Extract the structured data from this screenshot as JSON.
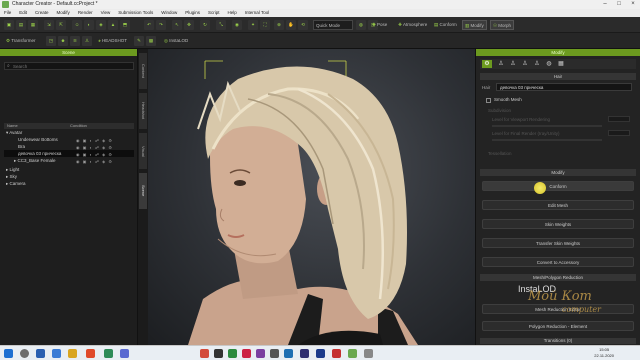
{
  "titlebar": {
    "title": "Character Creator - Default.ccProject *"
  },
  "menubar": {
    "items": [
      "File",
      "Edit",
      "Create",
      "Modify",
      "Render",
      "View",
      "Submission Tools",
      "Window",
      "Plugins",
      "Script",
      "Help",
      "Internal Tool"
    ]
  },
  "toolbar1": {
    "quick_mode": "Quick Mode",
    "pose": "Pose",
    "atmosphere": "Atmosphere",
    "conform": "Conform",
    "modify": "Modify",
    "morph": "Morph"
  },
  "toolbar2": {
    "transformer": "Transformer",
    "headshot": "HEADSHOT",
    "instalod": "InstaLOD"
  },
  "scene": {
    "title": "Scene",
    "search_placeholder": "Search",
    "columns": {
      "name": "Name",
      "condition": "Condition"
    },
    "rows": [
      {
        "label": "Avatar"
      },
      {
        "label": "Underwear Bottoms"
      },
      {
        "label": "Bra"
      },
      {
        "label": "девочка 03 прическа"
      },
      {
        "label": "CC3_Base Female"
      },
      {
        "label": "Light"
      },
      {
        "label": "Sky"
      },
      {
        "label": "Camera"
      }
    ]
  },
  "sidetabs": [
    "Content",
    "Headshot",
    "Visual",
    "Scene"
  ],
  "modify": {
    "title": "Modify",
    "hair_section": "Hair",
    "hair_label": "Hair",
    "hair_value": "девочка 03 прическа",
    "smooth_mesh": "Smooth Mesh",
    "subdivision": "Subdivision",
    "level_viewport": "Level for Viewport Rendering",
    "level_render": "Level for Final Render (Iray/Unity)",
    "tessellation": "Tessellation",
    "modify_section": "Modify",
    "buttons": [
      "Conform",
      "Edit Mesh",
      "Skin Weights",
      "Transfer Skin Weights",
      "Convert to Accessory"
    ],
    "mesh_section": "Mesh/Polygon Reduction",
    "instalod_logo": "InstaLOD",
    "mesh_buttons": [
      "Mesh Reduction Editor",
      "Polygon Reduction - Element"
    ],
    "transitions": "Transitions (0)"
  },
  "watermark": {
    "line1": "Мой Кот",
    "line2": "computer"
  },
  "taskbar": {
    "time": "15:05",
    "date": "22.11.2020"
  }
}
